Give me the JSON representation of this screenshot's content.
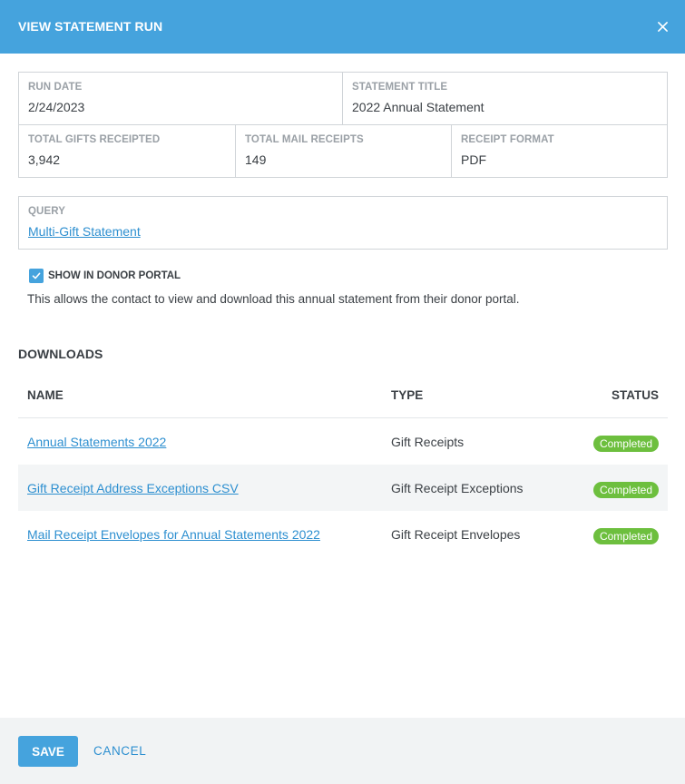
{
  "header": {
    "title": "VIEW STATEMENT RUN",
    "close_icon": "close-icon"
  },
  "details": {
    "run_date": {
      "label": "RUN DATE",
      "value": "2/24/2023"
    },
    "statement_title": {
      "label": "STATEMENT TITLE",
      "value": "2022 Annual Statement"
    },
    "total_gifts_receipted": {
      "label": "TOTAL GIFTS RECEIPTED",
      "value": "3,942"
    },
    "total_mail_receipts": {
      "label": "TOTAL MAIL RECEIPTS",
      "value": "149"
    },
    "receipt_format": {
      "label": "RECEIPT FORMAT",
      "value": "PDF"
    }
  },
  "query": {
    "label": "QUERY",
    "value": "Multi-Gift Statement"
  },
  "donor_portal": {
    "checked": true,
    "label": "SHOW IN DONOR PORTAL",
    "description": "This allows the contact to view and download this annual statement from their donor portal."
  },
  "downloads": {
    "title": "DOWNLOADS",
    "columns": [
      "NAME",
      "TYPE",
      "STATUS"
    ],
    "rows": [
      {
        "name": "Annual Statements 2022",
        "type": "Gift Receipts",
        "status": "Completed"
      },
      {
        "name": "Gift Receipt Address Exceptions CSV",
        "type": "Gift Receipt Exceptions",
        "status": "Completed"
      },
      {
        "name": "Mail Receipt Envelopes for Annual Statements 2022",
        "type": "Gift Receipt Envelopes",
        "status": "Completed"
      }
    ]
  },
  "footer": {
    "save_label": "SAVE",
    "cancel_label": "CANCEL"
  },
  "colors": {
    "header_bg": "#45a3dd",
    "link": "#2d8fd0",
    "status_completed": "#6dbf3e",
    "footer_bg": "#f1f3f4"
  }
}
